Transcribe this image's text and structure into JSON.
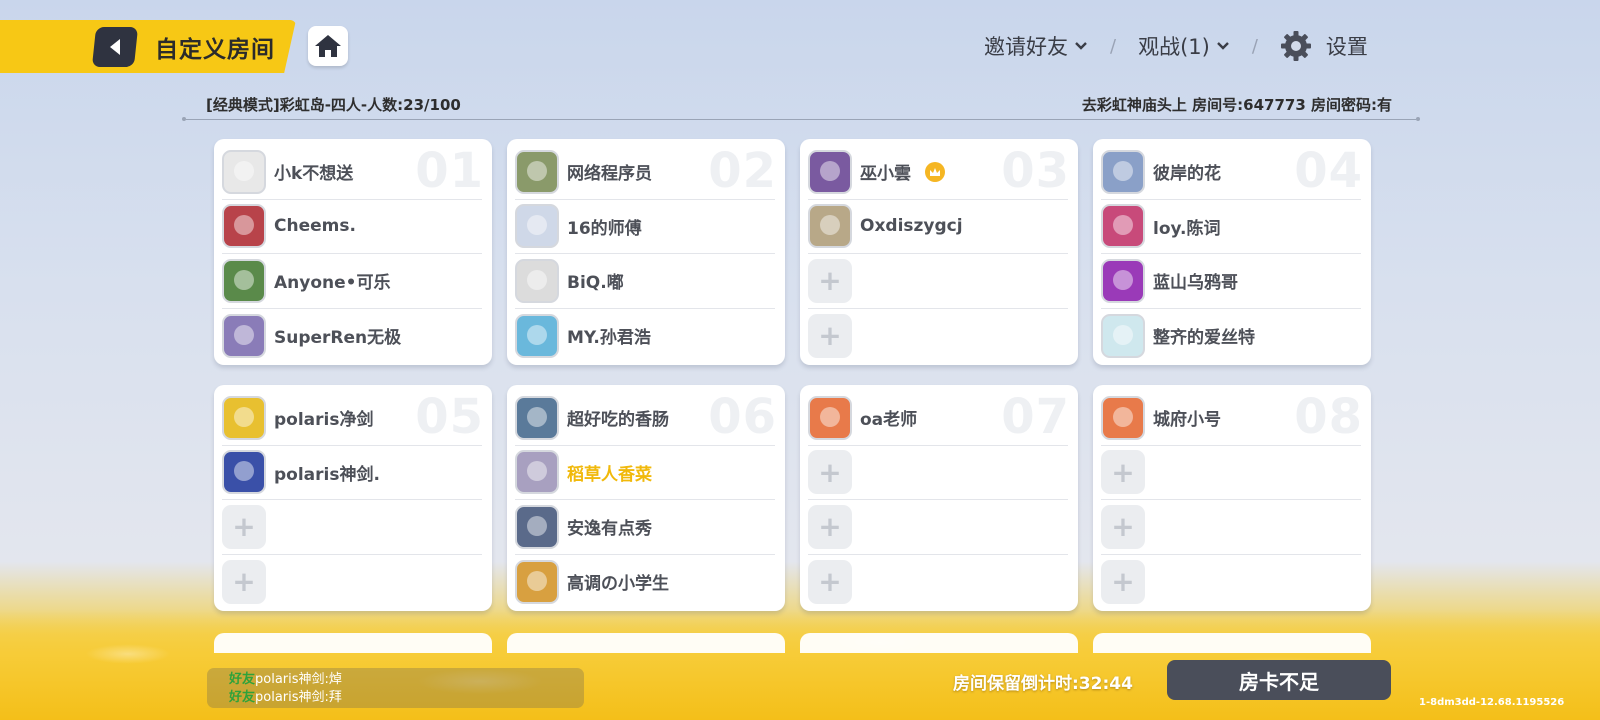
{
  "header": {
    "title": "自定义房间",
    "invite_label": "邀请好友",
    "spectate_label": "观战(1)",
    "settings_label": "设置"
  },
  "room": {
    "mode_info": "[经典模式]彩虹岛-四人-人数:23/100",
    "room_info": "去彩虹神庙头上 房间号:647773 房间密码:有"
  },
  "teams": [
    {
      "number": "01",
      "players": [
        {
          "name": "小k不想送",
          "avatar_color": "#e8e8e8"
        },
        {
          "name": "Cheems.",
          "avatar_color": "#b8434a"
        },
        {
          "name": "Anyone•可乐",
          "avatar_color": "#5a8a4a"
        },
        {
          "name": "SuperRen无极",
          "avatar_color": "#8a7cb8"
        }
      ]
    },
    {
      "number": "02",
      "players": [
        {
          "name": "网络程序员",
          "avatar_color": "#8a9a6a"
        },
        {
          "name": "16的师傅",
          "avatar_color": "#cfd8e8"
        },
        {
          "name": "BiQ.嘟",
          "avatar_color": "#dcdcdc"
        },
        {
          "name": "MY.孙君浩",
          "avatar_color": "#6ab8dc"
        }
      ]
    },
    {
      "number": "03",
      "players": [
        {
          "name": "巫小雲",
          "avatar_color": "#7a5aa0",
          "host": true
        },
        {
          "name": "Oxdiszygcj",
          "avatar_color": "#b8a888"
        },
        {
          "name": "",
          "empty": true
        },
        {
          "name": "",
          "empty": true
        }
      ]
    },
    {
      "number": "04",
      "players": [
        {
          "name": "彼岸的花",
          "avatar_color": "#8aa0c8"
        },
        {
          "name": "loy.陈词",
          "avatar_color": "#c84a7a"
        },
        {
          "name": "蓝山乌鸦哥",
          "avatar_color": "#9a3ab8"
        },
        {
          "name": "整齐的爱丝特",
          "avatar_color": "#cfe8ee"
        }
      ]
    },
    {
      "number": "05",
      "players": [
        {
          "name": "polaris净剑",
          "avatar_color": "#e8c030"
        },
        {
          "name": "polaris神剑.",
          "avatar_color": "#3a50a8"
        },
        {
          "name": "",
          "empty": true
        },
        {
          "name": "",
          "empty": true
        }
      ]
    },
    {
      "number": "06",
      "players": [
        {
          "name": "超好吃的香肠",
          "avatar_color": "#5a7a9a"
        },
        {
          "name": "稻草人香菜",
          "avatar_color": "#a8a0c0",
          "highlight": true
        },
        {
          "name": "安逸有点秀",
          "avatar_color": "#5a6a8a"
        },
        {
          "name": "高调の小学生",
          "avatar_color": "#d8a040"
        }
      ]
    },
    {
      "number": "07",
      "players": [
        {
          "name": "oa老师",
          "avatar_color": "#e87a4a"
        },
        {
          "name": "",
          "empty": true
        },
        {
          "name": "",
          "empty": true
        },
        {
          "name": "",
          "empty": true
        }
      ]
    },
    {
      "number": "08",
      "players": [
        {
          "name": "城府小号",
          "avatar_color": "#e87a4a"
        },
        {
          "name": "",
          "empty": true
        },
        {
          "name": "",
          "empty": true
        },
        {
          "name": "",
          "empty": true
        }
      ]
    }
  ],
  "chat": [
    {
      "tag": "好友",
      "speaker": "polaris神剑",
      "text": ":焯"
    },
    {
      "tag": "好友",
      "speaker": "polaris神剑",
      "text": ":拜"
    }
  ],
  "footer": {
    "countdown": "房间保留倒计时:32:44",
    "card_button": "房卡不足",
    "version": "1-8dm3dd-12.68.1195526"
  },
  "colors": {
    "accent_yellow": "#f7c815",
    "dark_button": "#4a4e5a",
    "highlight_name": "#f1b90b"
  }
}
